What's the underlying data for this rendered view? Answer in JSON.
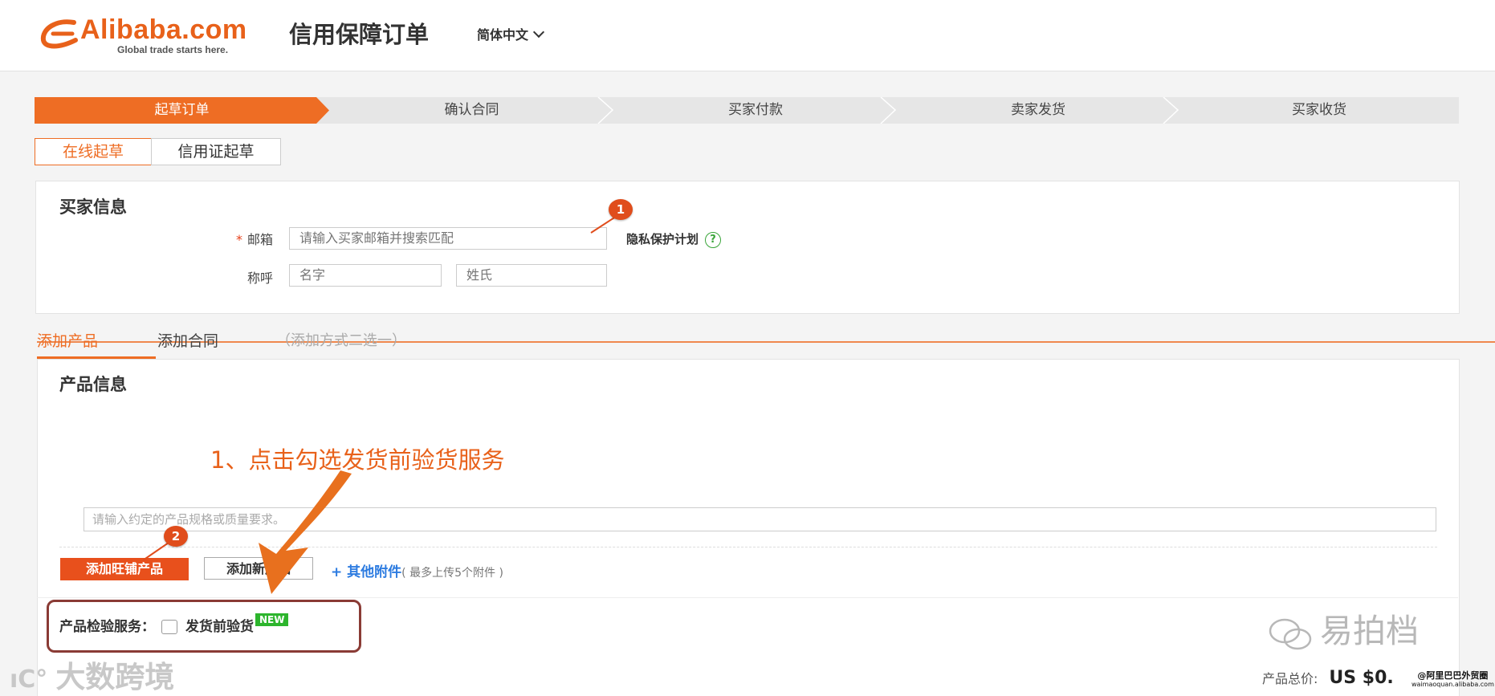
{
  "header": {
    "logo_name": "Alibaba.com",
    "logo_slogan": "Global trade starts here.",
    "title": "信用保障订单",
    "language": "简体中文"
  },
  "steps": [
    "起草订单",
    "确认合同",
    "买家付款",
    "卖家发货",
    "买家收货"
  ],
  "active_step": 0,
  "draft_tabs": [
    "在线起草",
    "信用证起草"
  ],
  "buyer": {
    "section_title": "买家信息",
    "email_label": "邮箱",
    "email_placeholder": "请输入买家邮箱并搜索匹配",
    "privacy_text": "隐私保护计划",
    "help_icon_text": "?",
    "name_label": "称呼",
    "first_name_placeholder": "名字",
    "last_name_placeholder": "姓氏"
  },
  "add_tabs": {
    "product": "添加产品",
    "contract": "添加合同",
    "note": "（添加方式二选一）"
  },
  "product": {
    "section_title": "产品信息",
    "spec_placeholder": "请输入约定的产品规格或质量要求。",
    "add_shop_product": "添加旺铺产品",
    "add_new_product": "添加新产品",
    "other_attachments": "+ 其他附件",
    "attachment_note": "( 最多上传5个附件 )"
  },
  "inspection": {
    "label": "产品检验服务：",
    "option": "发货前验货",
    "new_tag": "NEW",
    "checked": false
  },
  "annotation": {
    "instruction": "1、点击勾选发货前验货服务",
    "badge1": "1",
    "badge2": "2",
    "arrow_color": "#e8701e"
  },
  "total": {
    "label": "产品总价:",
    "value": "US $0."
  },
  "watermarks": {
    "right": "易拍档",
    "left": "大数跨境",
    "small_line1": "@阿里巴巴外贸圈",
    "small_line2": "waimaoquan.alibaba.com"
  },
  "colors": {
    "accent": "#ee6d24",
    "badge": "#e04d1c",
    "link": "#2c7be0",
    "new_tag": "#2db52d"
  }
}
